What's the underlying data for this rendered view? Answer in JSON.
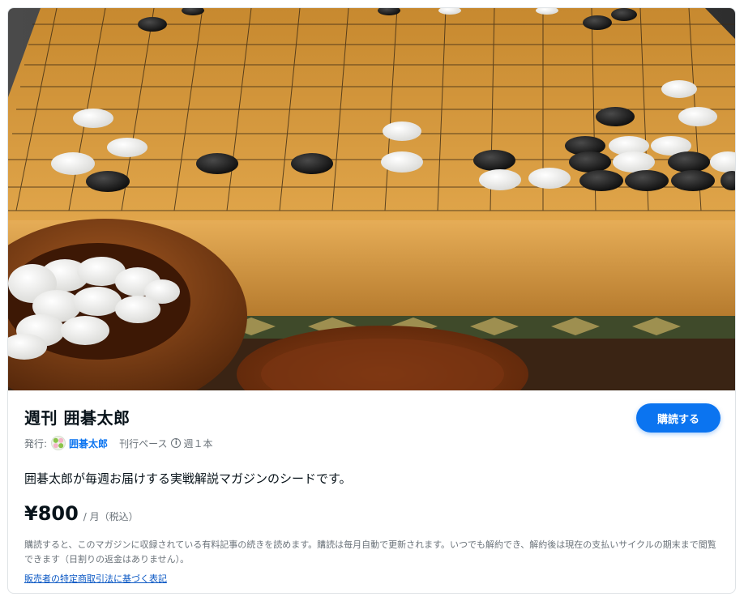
{
  "magazine": {
    "title": "週刊 囲碁太郎",
    "subscribe_label": "購読する",
    "publisher_label": "発行:",
    "publisher_name": "囲碁太郎",
    "pace_label": "刊行ペース",
    "pace_value": "週１本",
    "description": "囲碁太郎が毎週お届けする実戦解説マガジンのシードです。",
    "price": "¥800",
    "price_unit": "/ 月（税込）",
    "note": "購読すると、このマガジンに収録されている有料記事の続きを読めます。購読は毎月自動で更新されます。いつでも解約でき、解約後は現在の支払いサイクルの期末まで閲覧できます（日割りの返金はありません）。",
    "legal_link": "販売者の特定商取引法に基づく表記"
  },
  "icons": {
    "info": "info-icon",
    "publisher_avatar": "avatar"
  },
  "colors": {
    "accent": "#0b74f0",
    "link": "#0b58c4",
    "text": "#08131a",
    "muted": "#6b737a"
  }
}
